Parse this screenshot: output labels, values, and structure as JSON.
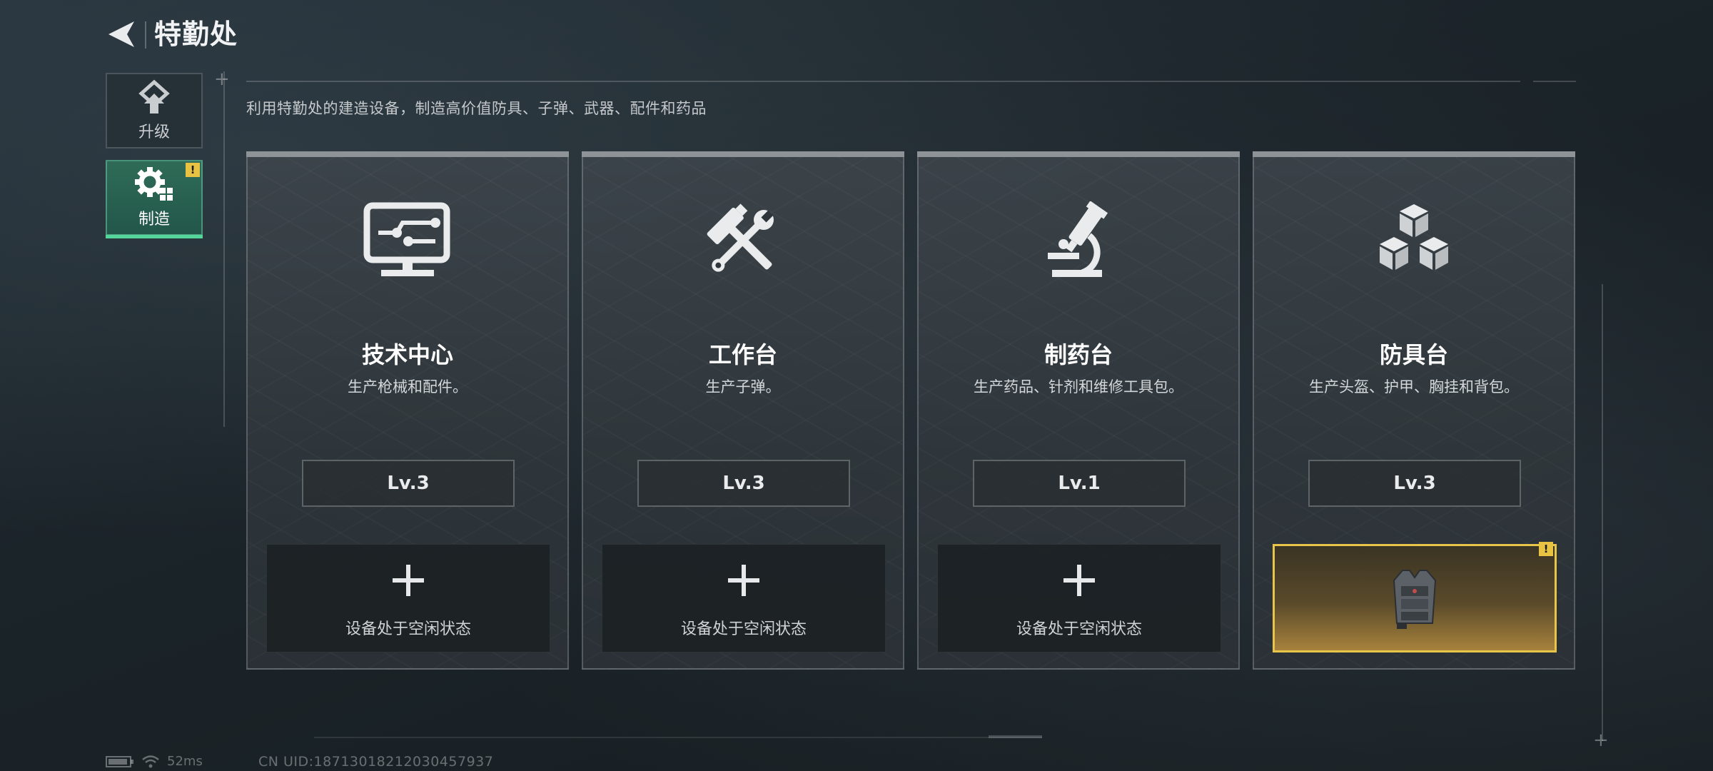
{
  "header": {
    "title": "特勤处"
  },
  "tabs": [
    {
      "label": "升级"
    },
    {
      "label": "制造",
      "badge": "!"
    }
  ],
  "subtitle": "利用特勤处的建造设备，制造高价值防具、子弹、武器、配件和药品",
  "cards": [
    {
      "icon": "computer-icon",
      "title": "技术中心",
      "desc": "生产枪械和配件。",
      "level": "Lv.3",
      "slot_text": "设备处于空闲状态"
    },
    {
      "icon": "hammer-wrench-icon",
      "title": "工作台",
      "desc": "生产子弹。",
      "level": "Lv.3",
      "slot_text": "设备处于空闲状态"
    },
    {
      "icon": "microscope-icon",
      "title": "制药台",
      "desc": "生产药品、针剂和维修工具包。",
      "level": "Lv.1",
      "slot_text": "设备处于空闲状态"
    },
    {
      "icon": "cubes-icon",
      "title": "防具台",
      "desc": "生产头盔、护甲、胸挂和背包。",
      "level": "Lv.3",
      "slot_badge": "!"
    }
  ],
  "footer": {
    "ping": "52ms",
    "uid": "CN UID:18713018212030457937"
  },
  "colors": {
    "active_tab": "#2f6b57",
    "active_underline": "#54d69b",
    "warning": "#e7c243",
    "producing_border": "#e8c448"
  }
}
